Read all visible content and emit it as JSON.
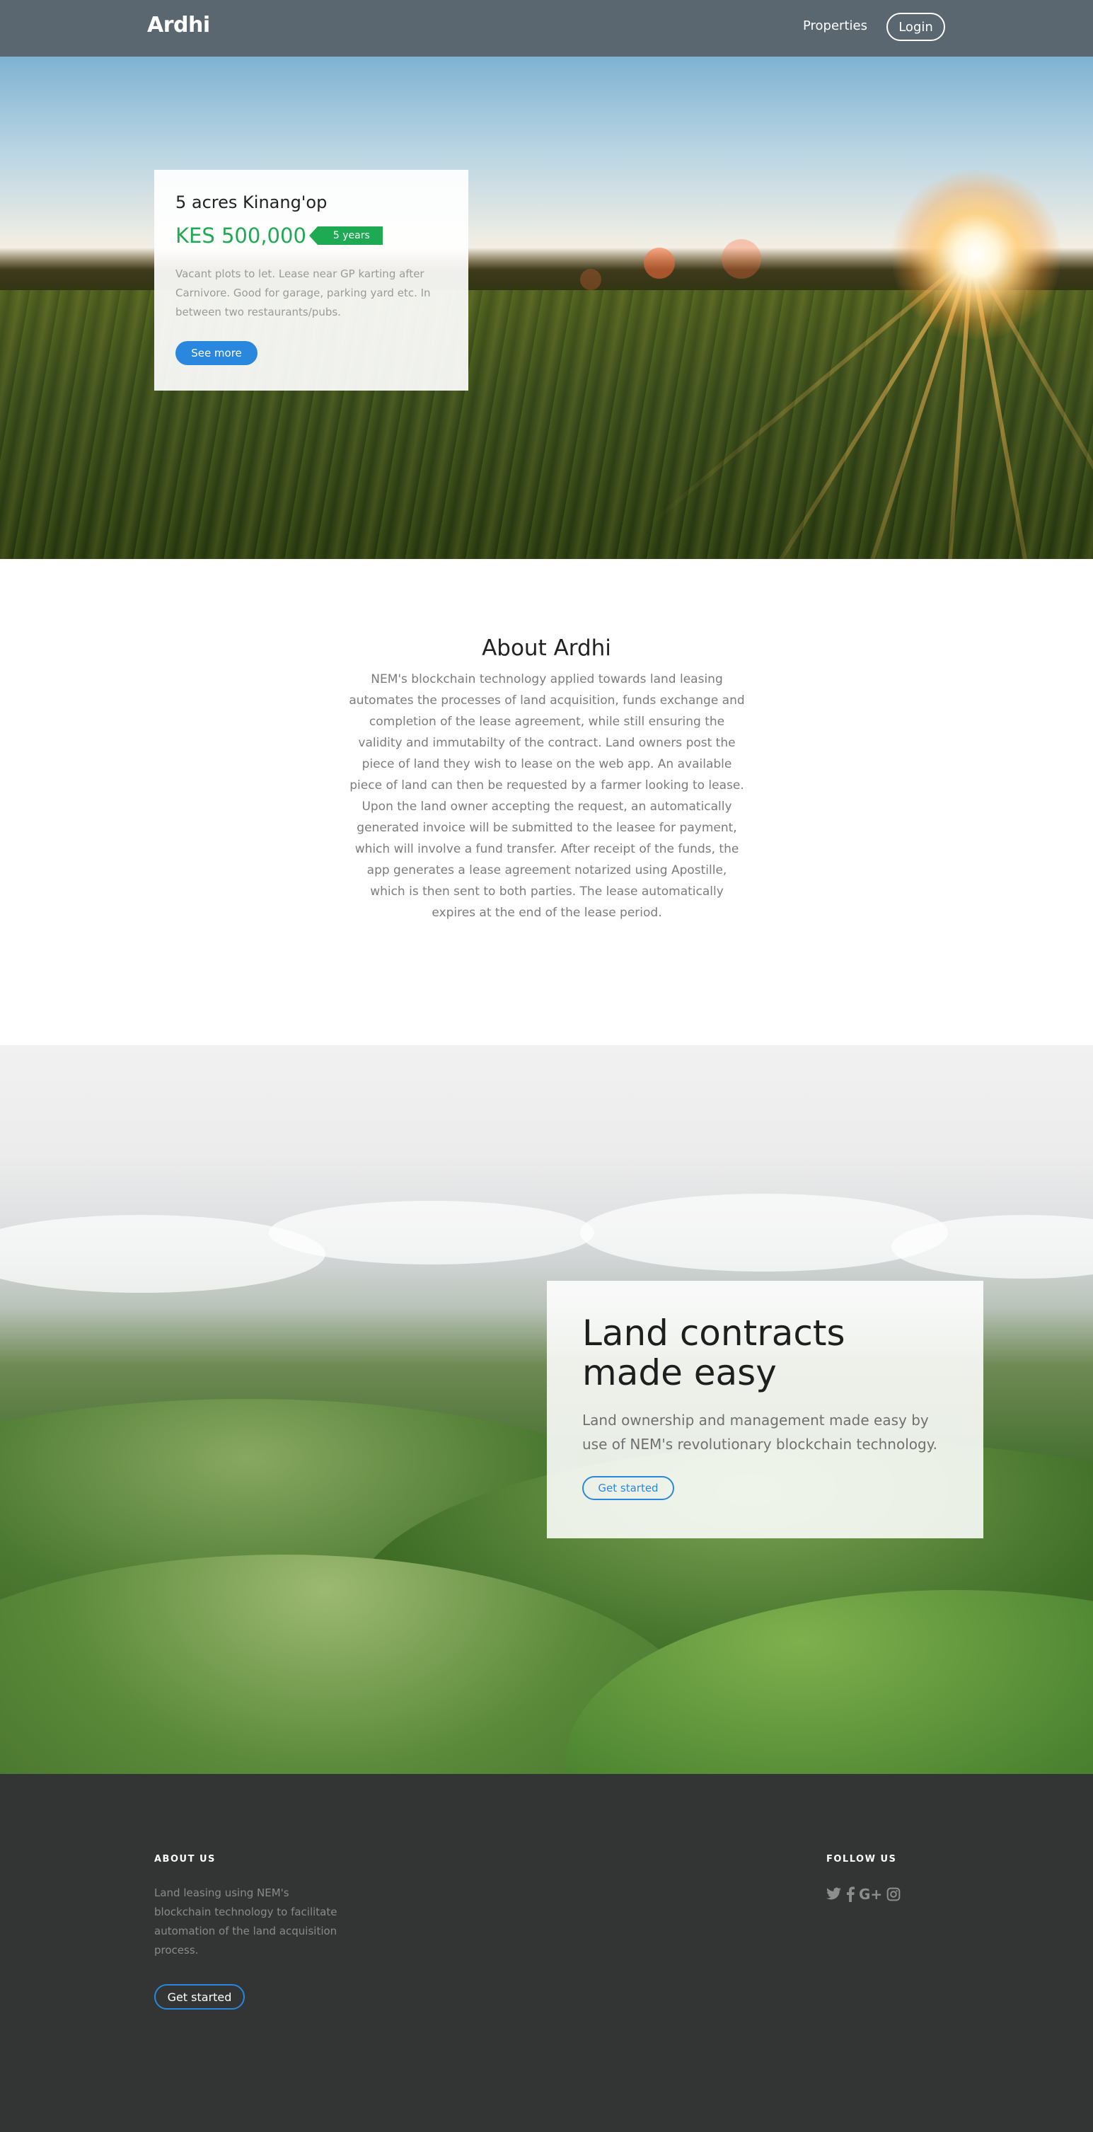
{
  "nav": {
    "brand": "Ardhi",
    "properties_label": "Properties",
    "login_label": "Login"
  },
  "listing": {
    "title": "5 acres Kinang'op",
    "price": "KES 500,000",
    "term": "5 years",
    "description": "Vacant plots to let. Lease near GP karting after Carnivore. Good for garage, parking yard etc. In between two restaurants/pubs.",
    "button_label": "See more"
  },
  "about": {
    "title": "About Ardhi",
    "text": "NEM's blockchain technology applied towards land leasing automates the processes of land acquisition, funds exchange and completion of the lease agreement, while still ensuring the validity and immutabilty of the contract. Land owners post the piece of land they wish to lease on the web app. An available piece of land can then be requested by a farmer looking to lease. Upon the land owner accepting the request, an automatically generated invoice will be submitted to the leasee for payment, which will involve a fund transfer. After receipt of the funds, the app generates a lease agreement notarized using Apostille, which is then sent to both parties. The lease automatically expires at the end of the lease period."
  },
  "promo": {
    "title": "Land contracts made easy",
    "text": "Land ownership and management made easy by use of NEM's revolutionary blockchain technology.",
    "button_label": "Get started"
  },
  "footer": {
    "about_heading": "ABOUT US",
    "about_text": "Land leasing using NEM's blockchain technology to facilitate automation of the land acquisition process.",
    "button_label": "Get started",
    "follow_heading": "FOLLOW US",
    "social_icons": [
      "twitter-icon",
      "facebook-icon",
      "google-plus-icon",
      "instagram-icon"
    ],
    "google_plus_glyph": "G+"
  },
  "colors": {
    "accent_blue": "#2a87de",
    "price_green": "#1daa52",
    "nav_bg": "#5a6670",
    "footer_bg": "#333434"
  }
}
